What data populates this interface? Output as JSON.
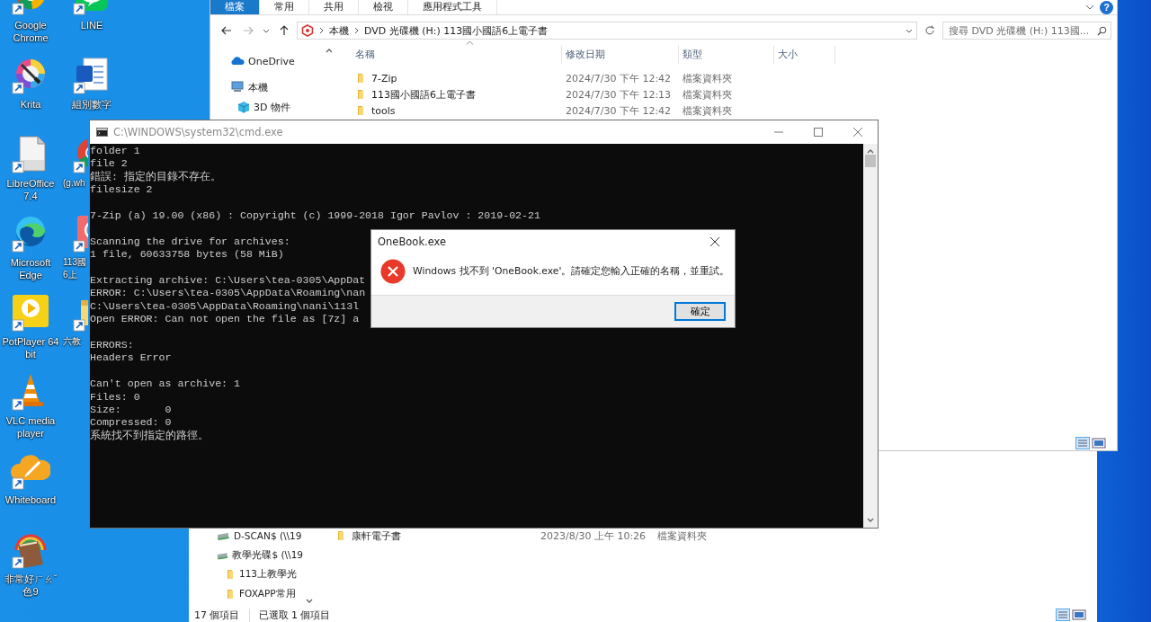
{
  "desktop": {
    "columns": [
      [
        {
          "label": "Google Chrome",
          "kind": "chrome"
        },
        {
          "label": "Krita",
          "kind": "krita"
        },
        {
          "label": "LibreOffice 7.4",
          "kind": "libre"
        },
        {
          "label": "Microsoft Edge",
          "kind": "edge"
        },
        {
          "label": "PotPlayer 64 bit",
          "kind": "potplayer"
        },
        {
          "label": "VLC media player",
          "kind": "vlc"
        },
        {
          "label": "Whiteboard",
          "kind": "whiteboard"
        },
        {
          "label": "非常好ㄏㄠˇ色9",
          "kind": "book"
        }
      ],
      [
        {
          "label": "LINE",
          "kind": "line"
        },
        {
          "label": "組別數字",
          "kind": "word"
        },
        {
          "label": "(g.wh",
          "kind": "chrome"
        },
        {
          "label": "113國 6上",
          "kind": "app"
        },
        {
          "label": "六教",
          "kind": "folder"
        }
      ]
    ]
  },
  "explorer_back": {
    "nav_items": [
      {
        "label": "D-SCAN$ (\\\\19",
        "kind": "drive"
      },
      {
        "label": "教學光碟$ (\\\\19",
        "kind": "drive",
        "children": [
          {
            "label": "113上教學光",
            "kind": "folder"
          },
          {
            "label": "FOXAPP常用",
            "kind": "folder"
          }
        ]
      }
    ],
    "files": [
      {
        "name": "康軒電子書",
        "modified": "2023/8/30 上午 10:26",
        "type": "檔案資料夾"
      }
    ],
    "status": [
      "17 個項目",
      "已選取 1 個項目"
    ]
  },
  "explorer_front": {
    "ribbon_tabs": [
      {
        "label": "檔案",
        "selected": true
      },
      {
        "label": "常用",
        "selected": false
      },
      {
        "label": "共用",
        "selected": false
      },
      {
        "label": "檢視",
        "selected": false
      },
      {
        "label": "應用程式工具",
        "selected": false
      }
    ],
    "help": "?",
    "address": {
      "crumbs": [
        "本機",
        "DVD 光碟機 (H:) 113國小國語6上電子書"
      ]
    },
    "search": {
      "placeholder": "搜尋 DVD 光碟機 (H:) 113國..."
    },
    "nav_items": [
      {
        "label": "OneDrive",
        "kind": "cloud"
      },
      {
        "label": "本機",
        "kind": "pc",
        "children": [
          {
            "label": "3D 物件",
            "kind": "cube"
          }
        ]
      }
    ],
    "columns": [
      "名稱",
      "修改日期",
      "類型",
      "大小"
    ],
    "files": [
      {
        "name": "7-Zip",
        "modified": "2024/7/30 下午 12:42",
        "type": "檔案資料夾"
      },
      {
        "name": "113國小國語6上電子書",
        "modified": "2024/7/30 下午 12:13",
        "type": "檔案資料夾"
      },
      {
        "name": "tools",
        "modified": "2024/7/30 下午 12:42",
        "type": "檔案資料夾"
      }
    ]
  },
  "console": {
    "title": "C:\\WINDOWS\\system32\\cmd.exe",
    "blocks": [
      [
        "folder 1",
        "file 2",
        "錯誤: 指定的目錄不存在。",
        "filesize 2"
      ],
      [
        "7-Zip (a) 19.00 (x86) : Copyright (c) 1999-2018 Igor Pavlov : 2019-02-21"
      ],
      [
        "Scanning the drive for archives:",
        "1 file, 60633758 bytes (58 MiB)"
      ],
      [
        "Extracting archive: C:\\Users\\tea-0305\\AppDat",
        "ERROR: C:\\Users\\tea-0305\\AppData\\Roaming\\nan",
        "C:\\Users\\tea-0305\\AppData\\Roaming\\nani\\113l",
        "Open ERROR: Can not open the file as [7z] a"
      ],
      [
        "ERRORS:",
        "Headers Error"
      ],
      [
        "Can't open as archive: 1",
        "Files: 0",
        "Size:       0",
        "Compressed: 0",
        "系統找不到指定的路徑。"
      ]
    ]
  },
  "dialog": {
    "title": "OneBook.exe",
    "message": "Windows 找不到 'OneBook.exe'。請確定您輸入正確的名稱，並重試。",
    "buttons": [
      {
        "label": "確定",
        "default": true
      }
    ]
  }
}
